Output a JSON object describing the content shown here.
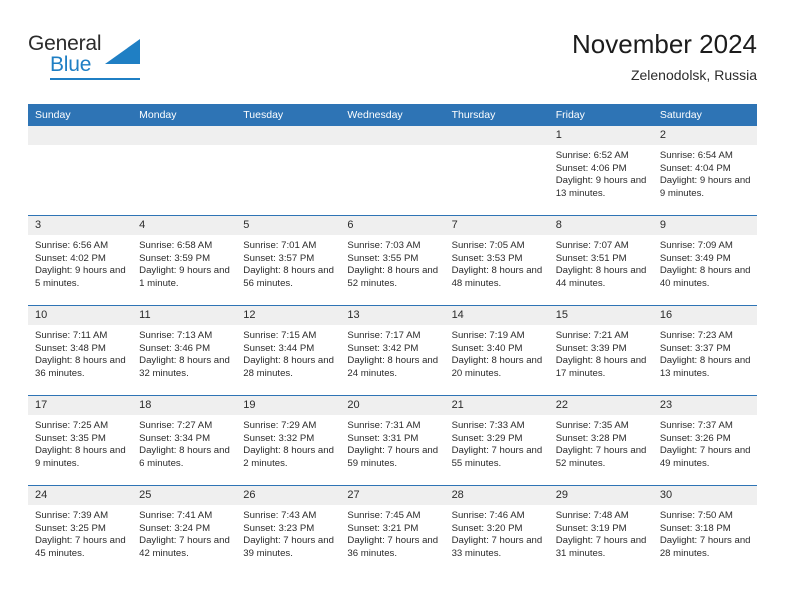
{
  "brand": {
    "name_part1": "General",
    "name_part2": "Blue",
    "logo_icon": "triangle-logo-icon",
    "accent_color": "#1f7fc4"
  },
  "header": {
    "title": "November 2024",
    "subtitle": "Zelenodolsk, Russia"
  },
  "theme": {
    "header_blue": "#2e74b5",
    "daynum_band": "#efefef",
    "text": "#2b2b2b"
  },
  "weekday_headers": [
    "Sunday",
    "Monday",
    "Tuesday",
    "Wednesday",
    "Thursday",
    "Friday",
    "Saturday"
  ],
  "weeks": [
    {
      "days": [
        {
          "day": "",
          "empty": true,
          "sunrise": "",
          "sunset": "",
          "daylight": ""
        },
        {
          "day": "",
          "empty": true,
          "sunrise": "",
          "sunset": "",
          "daylight": ""
        },
        {
          "day": "",
          "empty": true,
          "sunrise": "",
          "sunset": "",
          "daylight": ""
        },
        {
          "day": "",
          "empty": true,
          "sunrise": "",
          "sunset": "",
          "daylight": ""
        },
        {
          "day": "",
          "empty": true,
          "sunrise": "",
          "sunset": "",
          "daylight": ""
        },
        {
          "day": "1",
          "sunrise": "Sunrise: 6:52 AM",
          "sunset": "Sunset: 4:06 PM",
          "daylight": "Daylight: 9 hours and 13 minutes."
        },
        {
          "day": "2",
          "sunrise": "Sunrise: 6:54 AM",
          "sunset": "Sunset: 4:04 PM",
          "daylight": "Daylight: 9 hours and 9 minutes."
        }
      ]
    },
    {
      "days": [
        {
          "day": "3",
          "sunrise": "Sunrise: 6:56 AM",
          "sunset": "Sunset: 4:02 PM",
          "daylight": "Daylight: 9 hours and 5 minutes."
        },
        {
          "day": "4",
          "sunrise": "Sunrise: 6:58 AM",
          "sunset": "Sunset: 3:59 PM",
          "daylight": "Daylight: 9 hours and 1 minute."
        },
        {
          "day": "5",
          "sunrise": "Sunrise: 7:01 AM",
          "sunset": "Sunset: 3:57 PM",
          "daylight": "Daylight: 8 hours and 56 minutes."
        },
        {
          "day": "6",
          "sunrise": "Sunrise: 7:03 AM",
          "sunset": "Sunset: 3:55 PM",
          "daylight": "Daylight: 8 hours and 52 minutes."
        },
        {
          "day": "7",
          "sunrise": "Sunrise: 7:05 AM",
          "sunset": "Sunset: 3:53 PM",
          "daylight": "Daylight: 8 hours and 48 minutes."
        },
        {
          "day": "8",
          "sunrise": "Sunrise: 7:07 AM",
          "sunset": "Sunset: 3:51 PM",
          "daylight": "Daylight: 8 hours and 44 minutes."
        },
        {
          "day": "9",
          "sunrise": "Sunrise: 7:09 AM",
          "sunset": "Sunset: 3:49 PM",
          "daylight": "Daylight: 8 hours and 40 minutes."
        }
      ]
    },
    {
      "days": [
        {
          "day": "10",
          "sunrise": "Sunrise: 7:11 AM",
          "sunset": "Sunset: 3:48 PM",
          "daylight": "Daylight: 8 hours and 36 minutes."
        },
        {
          "day": "11",
          "sunrise": "Sunrise: 7:13 AM",
          "sunset": "Sunset: 3:46 PM",
          "daylight": "Daylight: 8 hours and 32 minutes."
        },
        {
          "day": "12",
          "sunrise": "Sunrise: 7:15 AM",
          "sunset": "Sunset: 3:44 PM",
          "daylight": "Daylight: 8 hours and 28 minutes."
        },
        {
          "day": "13",
          "sunrise": "Sunrise: 7:17 AM",
          "sunset": "Sunset: 3:42 PM",
          "daylight": "Daylight: 8 hours and 24 minutes."
        },
        {
          "day": "14",
          "sunrise": "Sunrise: 7:19 AM",
          "sunset": "Sunset: 3:40 PM",
          "daylight": "Daylight: 8 hours and 20 minutes."
        },
        {
          "day": "15",
          "sunrise": "Sunrise: 7:21 AM",
          "sunset": "Sunset: 3:39 PM",
          "daylight": "Daylight: 8 hours and 17 minutes."
        },
        {
          "day": "16",
          "sunrise": "Sunrise: 7:23 AM",
          "sunset": "Sunset: 3:37 PM",
          "daylight": "Daylight: 8 hours and 13 minutes."
        }
      ]
    },
    {
      "days": [
        {
          "day": "17",
          "sunrise": "Sunrise: 7:25 AM",
          "sunset": "Sunset: 3:35 PM",
          "daylight": "Daylight: 8 hours and 9 minutes."
        },
        {
          "day": "18",
          "sunrise": "Sunrise: 7:27 AM",
          "sunset": "Sunset: 3:34 PM",
          "daylight": "Daylight: 8 hours and 6 minutes."
        },
        {
          "day": "19",
          "sunrise": "Sunrise: 7:29 AM",
          "sunset": "Sunset: 3:32 PM",
          "daylight": "Daylight: 8 hours and 2 minutes."
        },
        {
          "day": "20",
          "sunrise": "Sunrise: 7:31 AM",
          "sunset": "Sunset: 3:31 PM",
          "daylight": "Daylight: 7 hours and 59 minutes."
        },
        {
          "day": "21",
          "sunrise": "Sunrise: 7:33 AM",
          "sunset": "Sunset: 3:29 PM",
          "daylight": "Daylight: 7 hours and 55 minutes."
        },
        {
          "day": "22",
          "sunrise": "Sunrise: 7:35 AM",
          "sunset": "Sunset: 3:28 PM",
          "daylight": "Daylight: 7 hours and 52 minutes."
        },
        {
          "day": "23",
          "sunrise": "Sunrise: 7:37 AM",
          "sunset": "Sunset: 3:26 PM",
          "daylight": "Daylight: 7 hours and 49 minutes."
        }
      ]
    },
    {
      "days": [
        {
          "day": "24",
          "sunrise": "Sunrise: 7:39 AM",
          "sunset": "Sunset: 3:25 PM",
          "daylight": "Daylight: 7 hours and 45 minutes."
        },
        {
          "day": "25",
          "sunrise": "Sunrise: 7:41 AM",
          "sunset": "Sunset: 3:24 PM",
          "daylight": "Daylight: 7 hours and 42 minutes."
        },
        {
          "day": "26",
          "sunrise": "Sunrise: 7:43 AM",
          "sunset": "Sunset: 3:23 PM",
          "daylight": "Daylight: 7 hours and 39 minutes."
        },
        {
          "day": "27",
          "sunrise": "Sunrise: 7:45 AM",
          "sunset": "Sunset: 3:21 PM",
          "daylight": "Daylight: 7 hours and 36 minutes."
        },
        {
          "day": "28",
          "sunrise": "Sunrise: 7:46 AM",
          "sunset": "Sunset: 3:20 PM",
          "daylight": "Daylight: 7 hours and 33 minutes."
        },
        {
          "day": "29",
          "sunrise": "Sunrise: 7:48 AM",
          "sunset": "Sunset: 3:19 PM",
          "daylight": "Daylight: 7 hours and 31 minutes."
        },
        {
          "day": "30",
          "sunrise": "Sunrise: 7:50 AM",
          "sunset": "Sunset: 3:18 PM",
          "daylight": "Daylight: 7 hours and 28 minutes."
        }
      ]
    }
  ]
}
